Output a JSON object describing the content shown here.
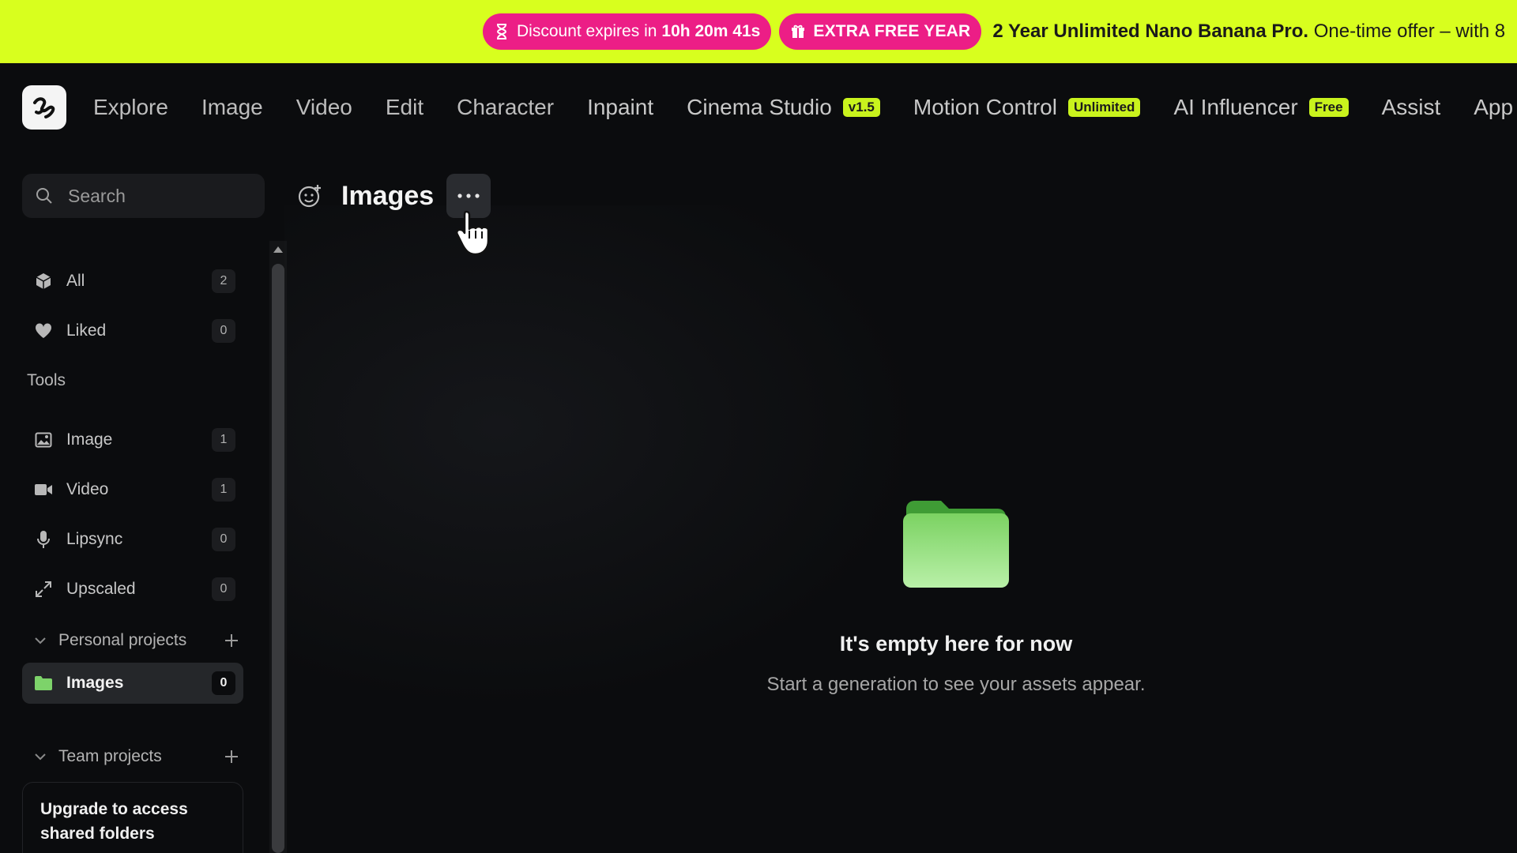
{
  "promo": {
    "discount_prefix": "Discount expires in",
    "discount_time": "10h 20m 41s",
    "extra_label": "EXTRA FREE YEAR",
    "offer_bold": "2 Year Unlimited Nano Banana Pro.",
    "offer_rest": "One-time offer – with 8",
    "colors": {
      "banner": "#d8ff1e",
      "pill": "#ec1e86"
    }
  },
  "nav": {
    "items": [
      {
        "label": "Explore"
      },
      {
        "label": "Image"
      },
      {
        "label": "Video"
      },
      {
        "label": "Edit"
      },
      {
        "label": "Character"
      },
      {
        "label": "Inpaint"
      },
      {
        "label": "Cinema Studio",
        "badge": "v1.5"
      },
      {
        "label": "Motion Control",
        "badge": "Unlimited"
      },
      {
        "label": "AI Influencer",
        "badge": "Free"
      },
      {
        "label": "Assist"
      },
      {
        "label": "App"
      }
    ],
    "badge_color": "#c9f31d"
  },
  "sidebar": {
    "search_placeholder": "Search",
    "library": [
      {
        "label": "All",
        "count": "2",
        "icon": "cube-icon"
      },
      {
        "label": "Liked",
        "count": "0",
        "icon": "heart-icon"
      }
    ],
    "tools_heading": "Tools",
    "tools": [
      {
        "label": "Image",
        "count": "1",
        "icon": "image-icon"
      },
      {
        "label": "Video",
        "count": "1",
        "icon": "video-camera-icon"
      },
      {
        "label": "Lipsync",
        "count": "0",
        "icon": "microphone-icon"
      },
      {
        "label": "Upscaled",
        "count": "0",
        "icon": "expand-arrows-icon"
      }
    ],
    "personal_projects": "Personal projects",
    "projects": [
      {
        "label": "Images",
        "count": "0",
        "icon": "folder-icon",
        "active": true
      }
    ],
    "team_projects": "Team projects",
    "upgrade_text": "Upgrade to access shared folders"
  },
  "main": {
    "title": "Images",
    "empty_title": "It's empty here for now",
    "empty_subtitle": "Start a generation to see your assets appear.",
    "folder_color": "#7dd36a"
  }
}
